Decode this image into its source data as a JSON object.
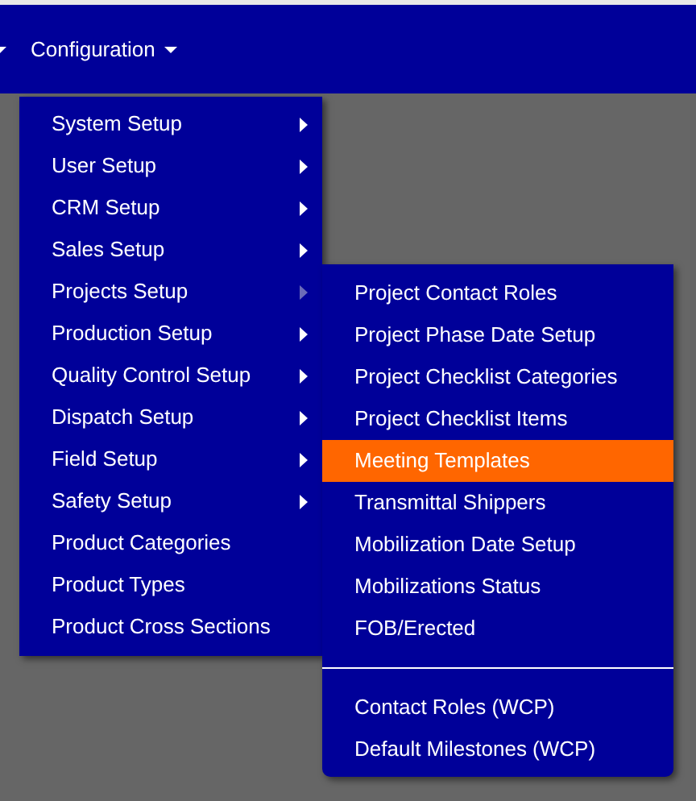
{
  "navbar": {
    "items": [
      {
        "label": "Configuration",
        "expanded": true
      }
    ]
  },
  "menu": {
    "items": [
      {
        "label": "System Setup",
        "has_submenu": true,
        "expanded": false
      },
      {
        "label": "User Setup",
        "has_submenu": true,
        "expanded": false
      },
      {
        "label": "CRM Setup",
        "has_submenu": true,
        "expanded": false
      },
      {
        "label": "Sales Setup",
        "has_submenu": true,
        "expanded": false
      },
      {
        "label": "Projects Setup",
        "has_submenu": true,
        "expanded": true
      },
      {
        "label": "Production Setup",
        "has_submenu": true,
        "expanded": false
      },
      {
        "label": "Quality Control Setup",
        "has_submenu": true,
        "expanded": false
      },
      {
        "label": "Dispatch Setup",
        "has_submenu": true,
        "expanded": false
      },
      {
        "label": "Field Setup",
        "has_submenu": true,
        "expanded": false
      },
      {
        "label": "Safety Setup",
        "has_submenu": true,
        "expanded": false
      },
      {
        "label": "Product Categories",
        "has_submenu": false,
        "expanded": false
      },
      {
        "label": "Product Types",
        "has_submenu": false,
        "expanded": false
      },
      {
        "label": "Product Cross Sections",
        "has_submenu": false,
        "expanded": false
      }
    ]
  },
  "submenu": {
    "items": [
      {
        "kind": "item",
        "label": "Project Contact Roles",
        "selected": false
      },
      {
        "kind": "item",
        "label": "Project Phase Date Setup",
        "selected": false
      },
      {
        "kind": "item",
        "label": "Project Checklist Categories",
        "selected": false
      },
      {
        "kind": "item",
        "label": "Project Checklist Items",
        "selected": false
      },
      {
        "kind": "item",
        "label": "Meeting Templates",
        "selected": true
      },
      {
        "kind": "item",
        "label": "Transmittal Shippers",
        "selected": false
      },
      {
        "kind": "item",
        "label": "Mobilization Date Setup",
        "selected": false
      },
      {
        "kind": "item",
        "label": "Mobilizations Status",
        "selected": false
      },
      {
        "kind": "item",
        "label": "FOB/Erected",
        "selected": false
      },
      {
        "kind": "divider"
      },
      {
        "kind": "item",
        "label": "Contact Roles (WCP)",
        "selected": false
      },
      {
        "kind": "item",
        "label": "Default Milestones (WCP)",
        "selected": false
      }
    ]
  }
}
